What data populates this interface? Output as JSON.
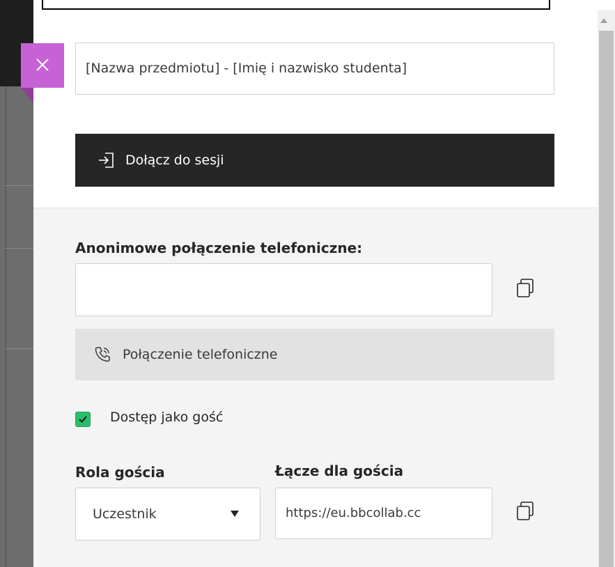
{
  "session": {
    "name_value": "[Nazwa przedmiotu] - [Imię i nazwisko studenta]",
    "join_label": "Dołącz do sesji"
  },
  "phone": {
    "heading": "Anonimowe połączenie telefoniczne:",
    "input_value": "",
    "button_label": "Połączenie telefoniczne"
  },
  "guest": {
    "access_label": "Dostęp jako gość",
    "access_checked": true,
    "role_heading": "Rola gościa",
    "role_selected": "Uczestnik",
    "link_heading": "Łącze dla gościa",
    "link_value": "https://eu.bbcollab.cc"
  },
  "icons": {
    "close": "close-icon",
    "join": "enter-session-icon",
    "copy": "copy-icon",
    "phone": "phone-icon",
    "check": "check-icon",
    "dropdown": "chevron-down-icon"
  },
  "colors": {
    "accent_close": "#c662d5",
    "join_bg": "#262626",
    "checkbox": "#2bbd6a",
    "section_bg": "#f4f4f4"
  }
}
